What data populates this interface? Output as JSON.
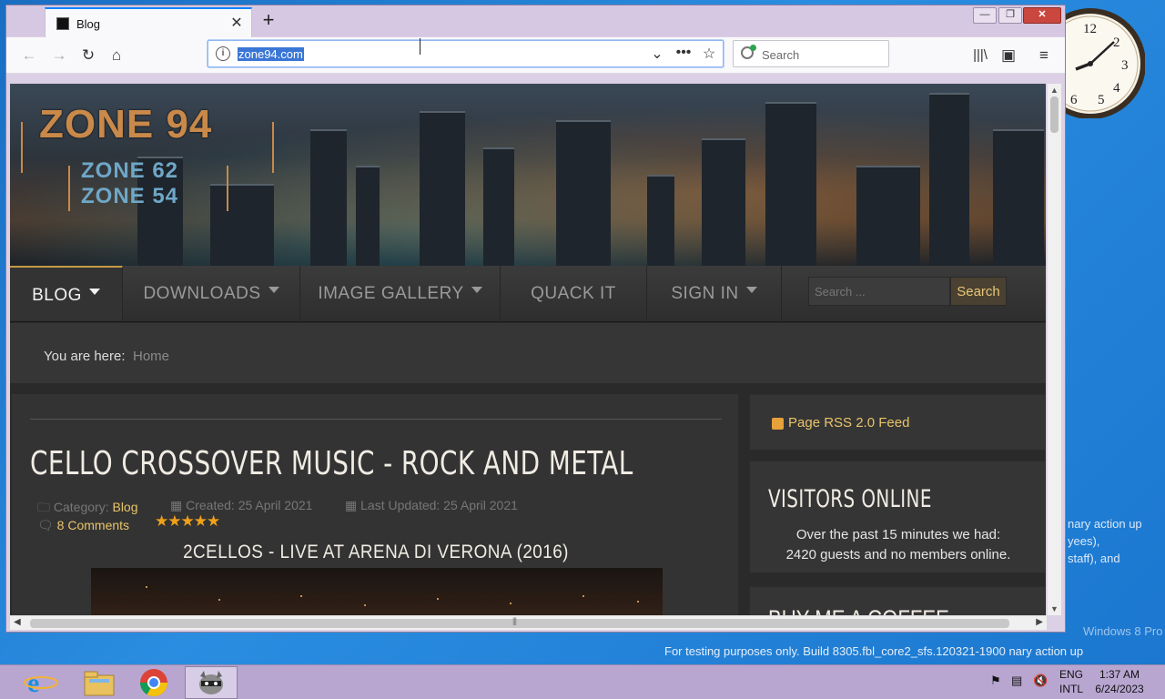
{
  "browser": {
    "tab_title": "Blog",
    "url": "zone94.com",
    "search_placeholder": "Search"
  },
  "site": {
    "logo_lines": [
      "ZONE 94",
      "ZONE 62",
      "ZONE 54"
    ],
    "menu": [
      {
        "label": "BLOG",
        "dropdown": true,
        "active": true
      },
      {
        "label": "DOWNLOADS",
        "dropdown": true,
        "active": false
      },
      {
        "label": "IMAGE GALLERY",
        "dropdown": true,
        "active": false
      },
      {
        "label": "QUACK IT",
        "dropdown": false,
        "active": false
      },
      {
        "label": "SIGN IN",
        "dropdown": true,
        "active": false
      }
    ],
    "menu_search_placeholder": "Search ...",
    "menu_search_button": "Search",
    "breadcrumb_label": "You are here:",
    "breadcrumb_home": "Home"
  },
  "article": {
    "title": "CELLO CROSSOVER MUSIC - ROCK AND METAL",
    "category_label": "Category:",
    "category": "Blog",
    "created": "Created: 25 April 2021",
    "updated": "Last Updated: 25 April 2021",
    "comments": "8 Comments",
    "rating_stars": 5,
    "subheading": "2CELLOS - LIVE AT ARENA DI VERONA (2016)"
  },
  "sidebar": {
    "rss": "Page RSS 2.0 Feed",
    "visitors_title": "VISITORS ONLINE",
    "visitors_line1": "Over the past 15 minutes we had:",
    "visitors_line2": "2420 guests and no members online.",
    "coffee_title": "BUY ME A COFFEE"
  },
  "desktop": {
    "note_lines": [
      "nary action up",
      "yees),",
      "staff), and"
    ],
    "watermark": "Windows 8 Pro",
    "build_text": "For testing purposes only. Build 8305.fbl_core2_sfs.120321-1900 nary action up"
  },
  "taskbar": {
    "lang_top": "ENG",
    "lang_bottom": "INTL",
    "time": "1:37 AM",
    "date": "6/24/2023"
  },
  "colors": {
    "accent": "#e9c46a",
    "menu_active_border": "#c59a45",
    "url_highlight": "#3a76d6"
  }
}
